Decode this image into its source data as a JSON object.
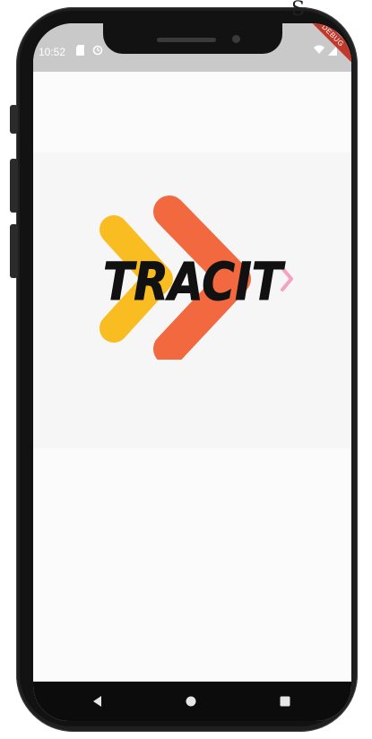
{
  "device": {
    "corner_glyph": "S"
  },
  "status_bar": {
    "time": "10:52",
    "icons": [
      "sd-card-icon",
      "sync-icon",
      "wifi-icon",
      "signal-icon"
    ],
    "debug_banner": "DEBUG"
  },
  "app": {
    "logo_text": "TRACIT",
    "colors": {
      "arrow_yellow": "#F9BD21",
      "arrow_orange": "#F2683F",
      "arrow_pink": "#F4A1C2",
      "text": "#111111"
    }
  },
  "nav_bar": {
    "buttons": [
      "back-icon",
      "home-icon",
      "recents-icon"
    ]
  }
}
